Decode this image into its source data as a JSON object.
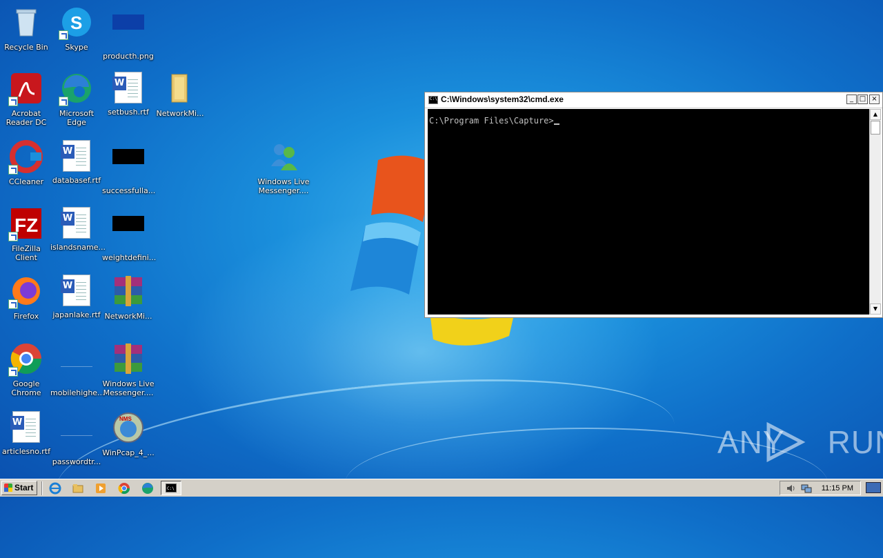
{
  "desktop": {
    "icons": [
      {
        "label": "Recycle Bin"
      },
      {
        "label": "Skype"
      },
      {
        "label": "producth.png"
      },
      {
        "label": "Acrobat Reader DC"
      },
      {
        "label": "Microsoft Edge"
      },
      {
        "label": "setbush.rtf"
      },
      {
        "label": "NetworkMi..."
      },
      {
        "label": "CCleaner"
      },
      {
        "label": "databasef.rtf"
      },
      {
        "label": "successfulla..."
      },
      {
        "label": "Windows Live Messenger...."
      },
      {
        "label": "FileZilla Client"
      },
      {
        "label": "islandsname..."
      },
      {
        "label": "weightdefini..."
      },
      {
        "label": "Firefox"
      },
      {
        "label": "japanlake.rtf"
      },
      {
        "label": "NetworkMi..."
      },
      {
        "label": "Google Chrome"
      },
      {
        "label": "mobilehighe..."
      },
      {
        "label": "Windows Live Messenger...."
      },
      {
        "label": "articlesno.rtf"
      },
      {
        "label": "passwordtr..."
      },
      {
        "label": "WinPcap_4_..."
      }
    ]
  },
  "cmd_window": {
    "title": "C:\\Windows\\system32\\cmd.exe",
    "prompt": "C:\\Program Files\\Capture>",
    "minimize": "_",
    "maximize": "□",
    "close": "×"
  },
  "taskbar": {
    "start_label": "Start",
    "clock": "11:15 PM"
  },
  "watermark": {
    "left": "ANY",
    "right": "RUN"
  },
  "colors": {
    "desktop_bg": "#1a8fdc",
    "taskbar_bg": "#d4d0c8",
    "console_bg": "#000000",
    "console_fg": "#c0c0c0"
  }
}
